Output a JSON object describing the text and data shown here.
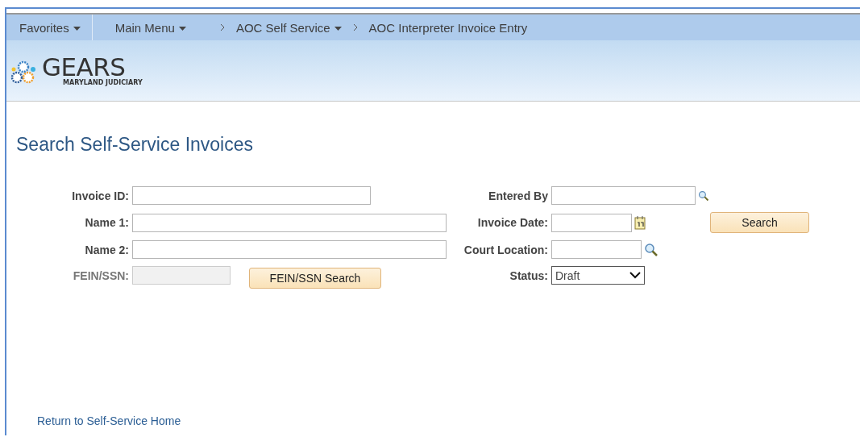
{
  "nav": [
    {
      "label": "Favorites",
      "dropdown": true,
      "kind": "menu"
    },
    {
      "label": "Main Menu",
      "dropdown": true,
      "kind": "crumb"
    },
    {
      "label": "AOC Self Service",
      "dropdown": true,
      "kind": "crumb"
    },
    {
      "label": "AOC Interpreter Invoice Entry",
      "dropdown": false,
      "kind": "crumb"
    }
  ],
  "logo": {
    "name": "GEARS",
    "subtitle": "MARYLAND JUDICIARY"
  },
  "page_title": "Search Self-Service Invoices",
  "left_fields": [
    {
      "label": "Invoice ID:",
      "disabled": false
    },
    {
      "label": "Name 1:",
      "disabled": false
    },
    {
      "label": "Name 2:",
      "disabled": false
    },
    {
      "label": "FEIN/SSN:",
      "disabled": true,
      "button": "FEIN/SSN Search"
    }
  ],
  "right_fields": [
    {
      "label": "Entered By",
      "kind": "lookup"
    },
    {
      "label": "Invoice Date:",
      "kind": "date"
    },
    {
      "label": "Court Location:",
      "kind": "lookup"
    },
    {
      "label": "Status:",
      "kind": "select",
      "value": "Draft"
    }
  ],
  "search_button": "Search",
  "footer_link": "Return to Self-Service Home"
}
